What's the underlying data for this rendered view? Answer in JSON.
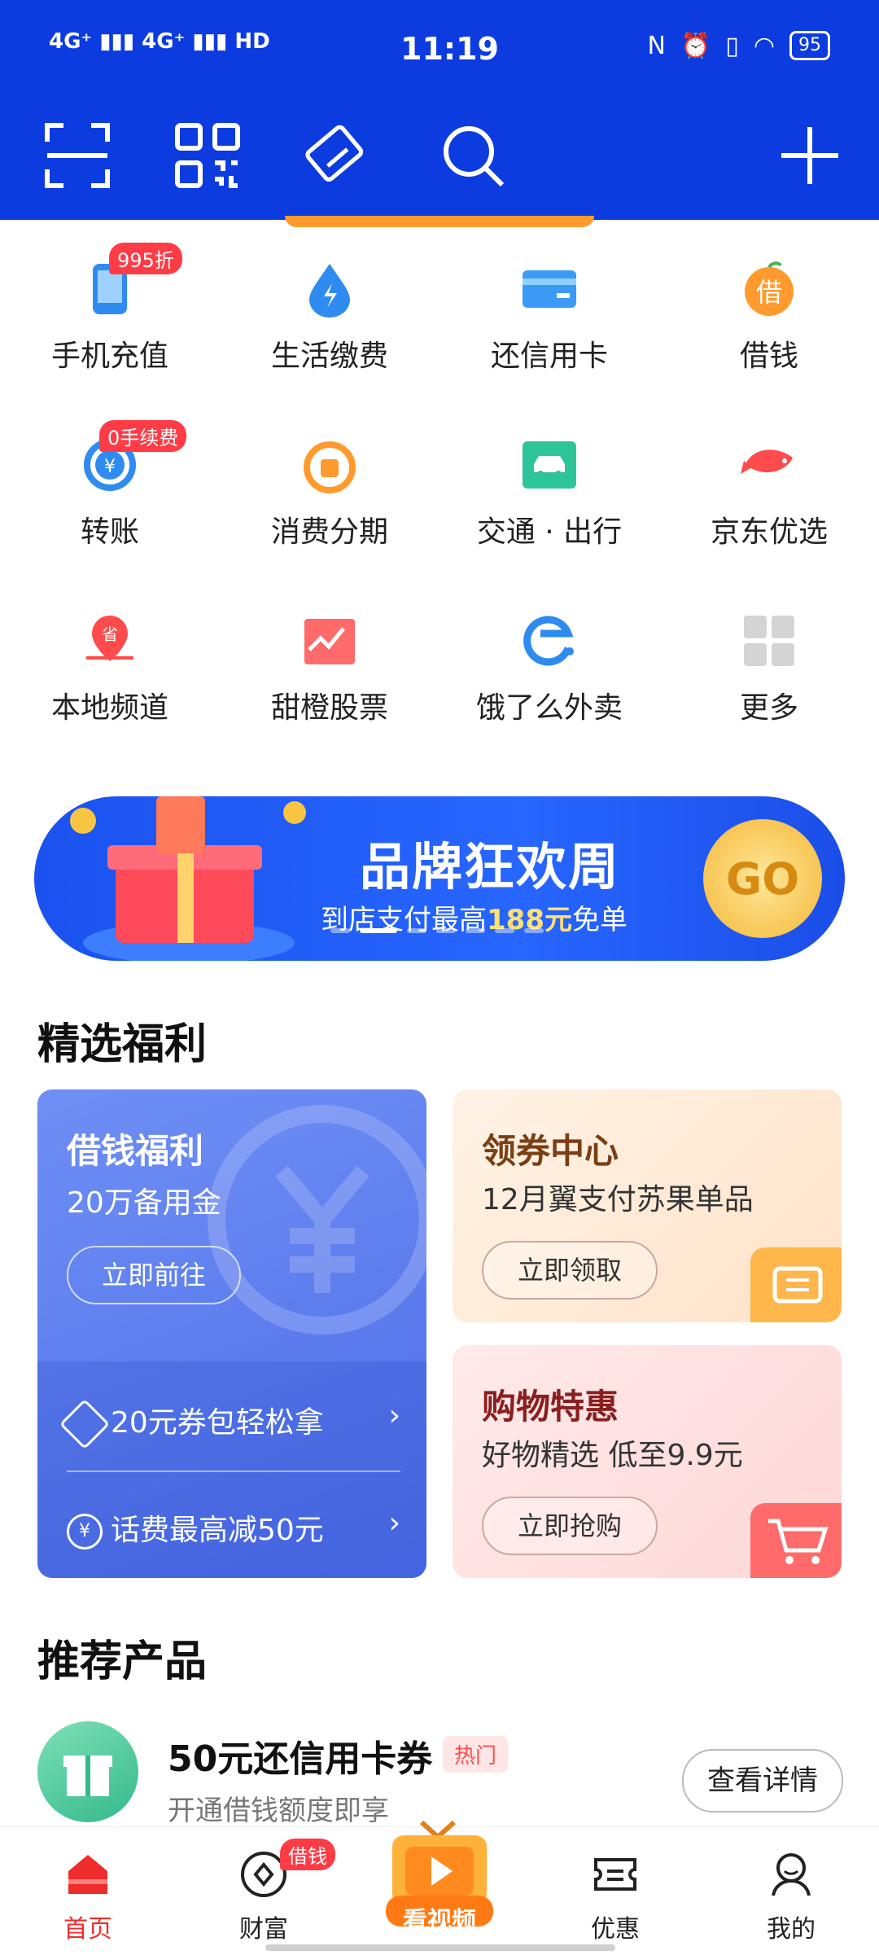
{
  "status_bar": {
    "time": "11:19",
    "network_left": "4G⁺ ▮▮▮ 4G⁺ ▮▮▮ HD",
    "battery": "95"
  },
  "top_nav": {
    "icons": [
      "scan-icon",
      "qr-code-icon",
      "payment-card-icon",
      "search-icon",
      "plus-icon"
    ]
  },
  "services": [
    {
      "label": "手机充值",
      "icon": "phone-icon",
      "badge": "995折",
      "color": "#2f8bf0"
    },
    {
      "label": "生活缴费",
      "icon": "water-drop-icon",
      "badge": "",
      "color": "#2f8bf0"
    },
    {
      "label": "还信用卡",
      "icon": "credit-card-icon",
      "badge": "",
      "color": "#2f8bf0"
    },
    {
      "label": "借钱",
      "icon": "borrow-icon",
      "badge": "",
      "color": "#ff9b2e"
    },
    {
      "label": "转账",
      "icon": "transfer-icon",
      "badge": "0手续费",
      "color": "#2f8bf0"
    },
    {
      "label": "消费分期",
      "icon": "shopping-bag-icon",
      "badge": "",
      "color": "#ff9b2e"
    },
    {
      "label": "交通 · 出行",
      "icon": "car-icon",
      "badge": "",
      "color": "#2ec49a"
    },
    {
      "label": "京东优选",
      "icon": "jd-dog-icon",
      "badge": "",
      "color": "#ff4b4b"
    },
    {
      "label": "本地频道",
      "icon": "location-pin-icon",
      "badge": "",
      "color": "#ff4b4b"
    },
    {
      "label": "甜橙股票",
      "icon": "stock-chart-icon",
      "badge": "",
      "color": "#ff4b4b"
    },
    {
      "label": "饿了么外卖",
      "icon": "eleme-icon",
      "badge": "",
      "color": "#2f8bf0"
    },
    {
      "label": "更多",
      "icon": "more-grid-icon",
      "badge": "",
      "color": "#cccccc"
    }
  ],
  "banner": {
    "title": "品牌狂欢周",
    "sub_prefix": "到店支付最高",
    "sub_highlight": "188元",
    "sub_suffix": "免单",
    "go": "GO",
    "page_count": 7,
    "active_page": 2
  },
  "featured": {
    "title": "精选福利",
    "loan_card": {
      "title": "借钱福利",
      "subtitle": "20万备用金",
      "button": "立即前往",
      "rows": [
        {
          "text": "20元券包轻松拿",
          "icon": "coupon-tag-icon"
        },
        {
          "text": "话费最高减50元",
          "icon": "yuan-circle-icon"
        }
      ]
    },
    "coupon_card": {
      "title": "领券中心",
      "subtitle": "12月翼支付苏果单品",
      "button": "立即领取"
    },
    "shopping_card": {
      "title": "购物特惠",
      "subtitle": "好物精选  低至9.9元",
      "button": "立即抢购"
    }
  },
  "recommended": {
    "title": "推荐产品",
    "item": {
      "name": "50元还信用卡券",
      "tag": "热门",
      "desc": "开通借钱额度即享",
      "button": "查看详情"
    }
  },
  "tabbar": {
    "tabs": [
      {
        "label": "首页",
        "icon": "home-icon",
        "active": true,
        "badge": ""
      },
      {
        "label": "财富",
        "icon": "wealth-icon",
        "active": false,
        "badge": "借钱"
      },
      {
        "label": "看视频",
        "icon": "video-tv-icon",
        "active": false,
        "badge": ""
      },
      {
        "label": "优惠",
        "icon": "ticket-icon",
        "active": false,
        "badge": ""
      },
      {
        "label": "我的",
        "icon": "profile-icon",
        "active": false,
        "badge": ""
      }
    ]
  }
}
